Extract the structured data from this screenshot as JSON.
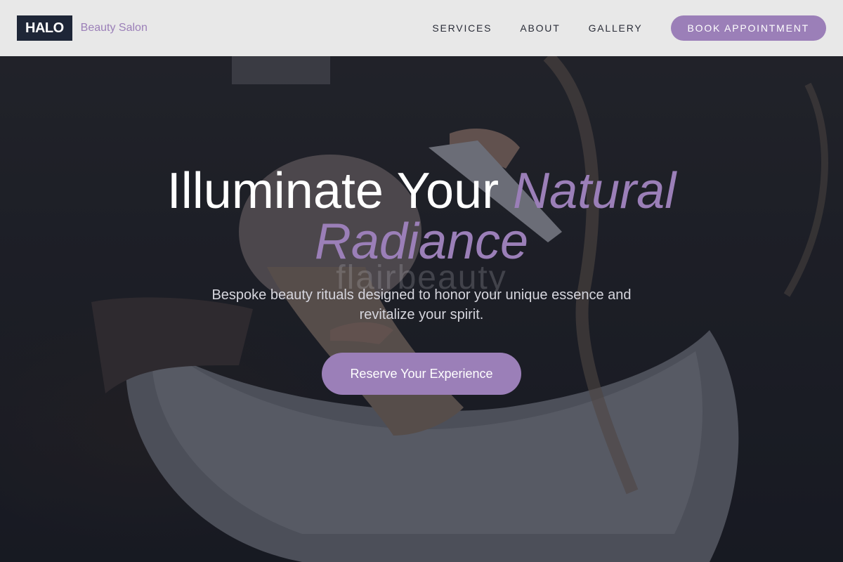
{
  "brand": {
    "logo": "HALO",
    "tagline": "Beauty Salon"
  },
  "nav": {
    "links": [
      "SERVICES",
      "ABOUT",
      "GALLERY"
    ],
    "cta": "BOOK APPOINTMENT"
  },
  "hero": {
    "title_plain": "Illuminate Your ",
    "title_accent": "Natural Radiance",
    "watermark": "flairbeauty",
    "subtitle": "Bespoke beauty rituals designed to honor your unique essence and revitalize your spirit.",
    "button": "Reserve Your Experience",
    "background_image": "salon-hair-wash-photo"
  },
  "colors": {
    "accent": "#9b7fb8",
    "logo_bg": "#1e2637",
    "header_bg": "#f0f0f0",
    "hero_text": "#ffffff"
  }
}
